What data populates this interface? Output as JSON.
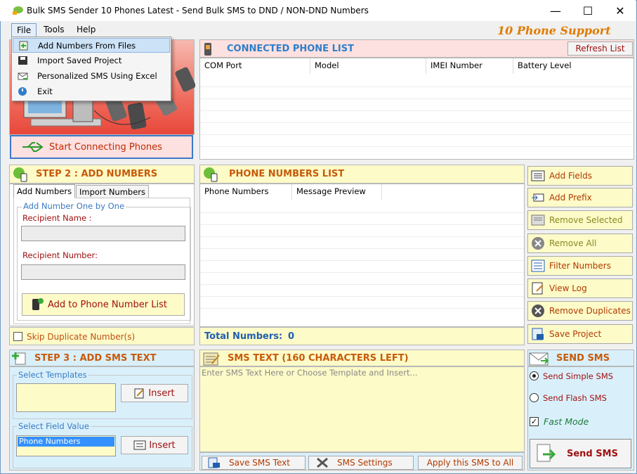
{
  "window": {
    "title": "Bulk SMS Sender 10 Phones Latest - Send Bulk SMS to DND / NON-DND Numbers",
    "minimize": "—",
    "maximize": "☐",
    "close": "✕"
  },
  "menu": {
    "items": [
      "File",
      "Tools",
      "Help"
    ],
    "phone_support": "10 Phone Support"
  },
  "file_menu": {
    "items": [
      "Add Numbers From Files",
      "Import Saved Project",
      "Personalized SMS Using Excel",
      "Exit"
    ]
  },
  "step1": {
    "start_button": "Start Connecting Phones"
  },
  "connected": {
    "title": "CONNECTED PHONE LIST",
    "refresh": "Refresh List",
    "columns": [
      "COM  Port",
      "Model",
      "IMEI Number",
      "Battery Level"
    ]
  },
  "step2": {
    "title": "STEP 2 : ADD NUMBERS",
    "tabs": [
      "Add Numbers",
      "Import Numbers"
    ],
    "group_title": "Add Number One by One",
    "recipient_name_label": "Recipient Name :",
    "recipient_name_value": "",
    "recipient_number_label": "Recipient Number:",
    "recipient_number_value": "",
    "add_button": "Add to Phone Number List",
    "skip_duplicates": "Skip Duplicate Number(s)"
  },
  "phone_numbers": {
    "title": "PHONE NUMBERS LIST",
    "columns": [
      "Phone Numbers",
      "Message Preview"
    ],
    "total_label": "Total Numbers:",
    "total_value": "0"
  },
  "side_buttons": [
    "Add Fields",
    "Add Prefix",
    "Remove Selected",
    "Remove All",
    "Filter Numbers",
    "View Log",
    "Remove Duplicates",
    "Save Project"
  ],
  "step3": {
    "title": "STEP 3 : ADD SMS TEXT",
    "templates_label": "Select Templates",
    "insert1": "Insert",
    "field_label": "Select Field Value",
    "field_selected": "Phone Numbers",
    "insert2": "Insert"
  },
  "sms_text": {
    "title": "SMS TEXT (160 CHARACTERS LEFT)",
    "placeholder": "Enter SMS Text Here or Choose Template and Insert...",
    "save": "Save SMS Text",
    "settings": "SMS Settings",
    "apply": "Apply this SMS to All"
  },
  "send": {
    "title": "SEND SMS",
    "simple": "Send Simple SMS",
    "flash": "Send Flash SMS",
    "fast": "Fast Mode",
    "button": "Send SMS"
  },
  "colors": {
    "accent_orange": "#e07b00",
    "header_blue": "#2f7fc9",
    "header_orange": "#c85a0a",
    "button_yellow": "#fdfbc8",
    "header_pink": "#fde0e0"
  }
}
